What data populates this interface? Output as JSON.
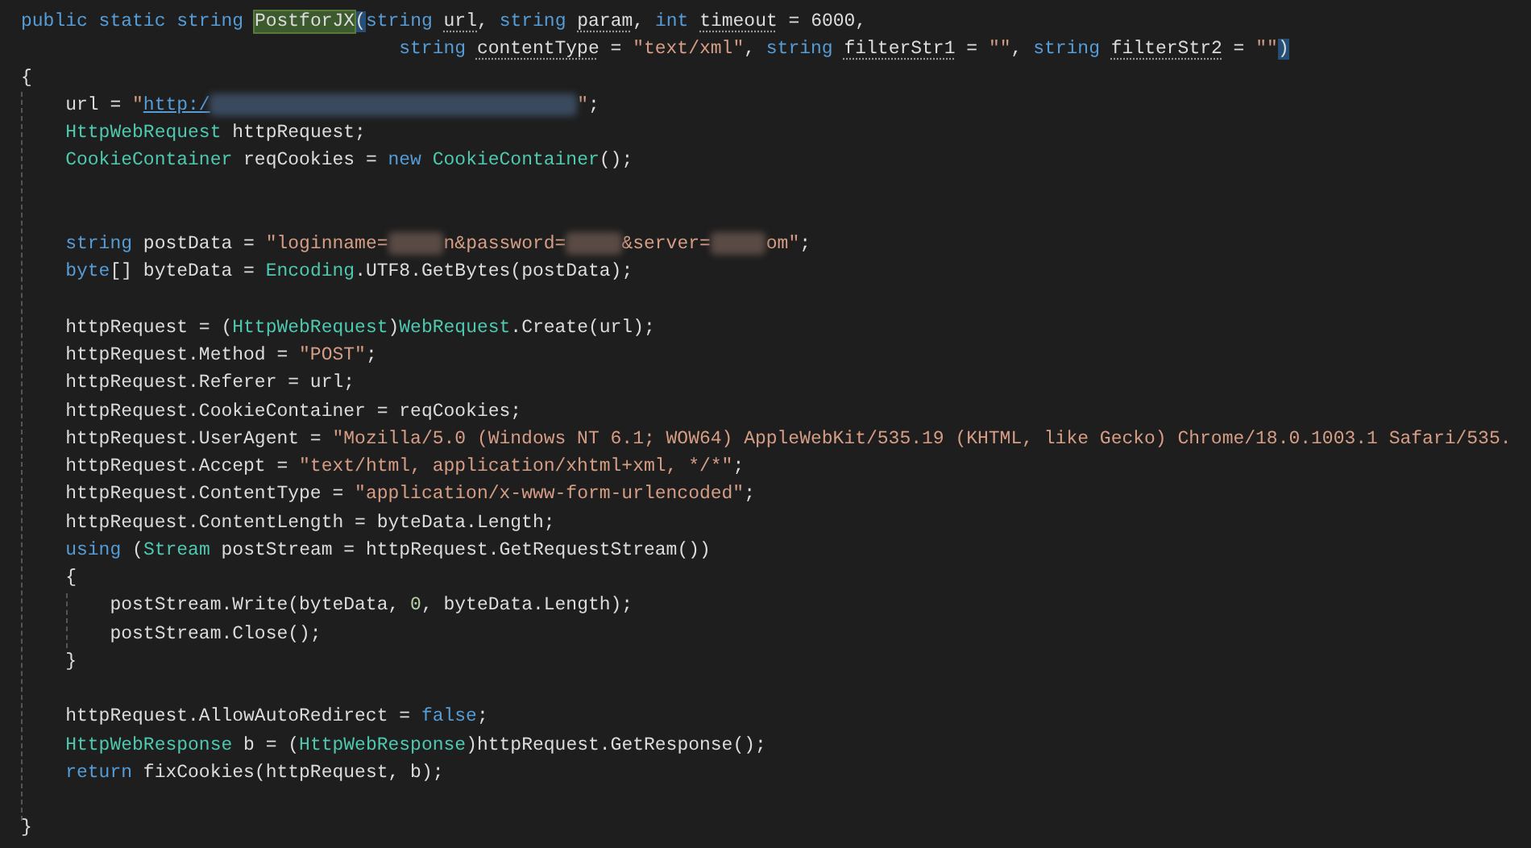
{
  "code_lines": [
    {
      "kind": "code",
      "tokens": [
        {
          "kind": "kw",
          "text": "public static string "
        },
        {
          "kind": "highlight",
          "text": "PostforJX"
        },
        {
          "kind": "match",
          "text": "("
        },
        {
          "kind": "kw",
          "text": "string "
        },
        {
          "kind": "hint",
          "text": "url"
        },
        {
          "kind": "plain",
          "text": ", "
        },
        {
          "kind": "kw",
          "text": "string "
        },
        {
          "kind": "hint",
          "text": "param"
        },
        {
          "kind": "plain",
          "text": ", "
        },
        {
          "kind": "kw",
          "text": "int "
        },
        {
          "kind": "hint",
          "text": "timeout"
        },
        {
          "kind": "plain",
          "text": " = 6000,"
        }
      ]
    },
    {
      "kind": "continuation",
      "tokens": [
        {
          "kind": "kw",
          "text": "string "
        },
        {
          "kind": "hint",
          "text": "contentType"
        },
        {
          "kind": "plain",
          "text": " = "
        },
        {
          "kind": "str",
          "text": "\"text/xml\""
        },
        {
          "kind": "plain",
          "text": ", "
        },
        {
          "kind": "kw",
          "text": "string "
        },
        {
          "kind": "hint",
          "text": "filterStr1"
        },
        {
          "kind": "plain",
          "text": " = "
        },
        {
          "kind": "str",
          "text": "\"\""
        },
        {
          "kind": "plain",
          "text": ", "
        },
        {
          "kind": "kw",
          "text": "string "
        },
        {
          "kind": "hint",
          "text": "filterStr2"
        },
        {
          "kind": "plain",
          "text": " = "
        },
        {
          "kind": "str",
          "text": "\"\""
        },
        {
          "kind": "match",
          "text": ")"
        }
      ]
    },
    {
      "kind": "code",
      "tokens": [
        {
          "kind": "plain",
          "text": "{"
        }
      ]
    },
    {
      "kind": "code",
      "tokens": [
        {
          "kind": "plain",
          "text": "    url = "
        },
        {
          "kind": "str",
          "text": "\""
        },
        {
          "kind": "link",
          "text": "http:/"
        },
        {
          "kind": "redacted_long"
        },
        {
          "kind": "str",
          "text": "\""
        },
        {
          "kind": "plain",
          "text": ";"
        }
      ]
    },
    {
      "kind": "code",
      "tokens": [
        {
          "kind": "type",
          "text": "    HttpWebRequest"
        },
        {
          "kind": "plain",
          "text": " httpRequest;"
        }
      ]
    },
    {
      "kind": "code",
      "tokens": [
        {
          "kind": "type",
          "text": "    CookieContainer"
        },
        {
          "kind": "plain",
          "text": " reqCookies = "
        },
        {
          "kind": "kw",
          "text": "new "
        },
        {
          "kind": "type",
          "text": "CookieContainer"
        },
        {
          "kind": "plain",
          "text": "();"
        }
      ]
    },
    {
      "kind": "blank"
    },
    {
      "kind": "blank"
    },
    {
      "kind": "code",
      "tokens": [
        {
          "kind": "kw",
          "text": "    string"
        },
        {
          "kind": "plain",
          "text": " postData = "
        },
        {
          "kind": "str",
          "text": "\"loginname="
        },
        {
          "kind": "redacted"
        },
        {
          "kind": "str",
          "text": "n&password="
        },
        {
          "kind": "redacted"
        },
        {
          "kind": "str",
          "text": "&server="
        },
        {
          "kind": "redacted"
        },
        {
          "kind": "str",
          "text": "om\""
        },
        {
          "kind": "plain",
          "text": ";"
        }
      ]
    },
    {
      "kind": "code",
      "tokens": [
        {
          "kind": "kw",
          "text": "    byte"
        },
        {
          "kind": "plain",
          "text": "[] byteData = "
        },
        {
          "kind": "type",
          "text": "Encoding"
        },
        {
          "kind": "plain",
          "text": ".UTF8.GetBytes(postData);"
        }
      ]
    },
    {
      "kind": "blank"
    },
    {
      "kind": "code",
      "tokens": [
        {
          "kind": "plain",
          "text": "    httpRequest = ("
        },
        {
          "kind": "type",
          "text": "HttpWebRequest"
        },
        {
          "kind": "plain",
          "text": ")"
        },
        {
          "kind": "type",
          "text": "WebRequest"
        },
        {
          "kind": "plain",
          "text": ".Create(url);"
        }
      ]
    },
    {
      "kind": "code",
      "tokens": [
        {
          "kind": "plain",
          "text": "    httpRequest.Method = "
        },
        {
          "kind": "str",
          "text": "\"POST\""
        },
        {
          "kind": "plain",
          "text": ";"
        }
      ]
    },
    {
      "kind": "code",
      "tokens": [
        {
          "kind": "plain",
          "text": "    httpRequest.Referer = url;"
        }
      ]
    },
    {
      "kind": "code",
      "tokens": [
        {
          "kind": "plain",
          "text": "    httpRequest.CookieContainer = reqCookies;"
        }
      ]
    },
    {
      "kind": "code",
      "tokens": [
        {
          "kind": "plain",
          "text": "    httpRequest.UserAgent = "
        },
        {
          "kind": "str",
          "text": "\"Mozilla/5.0 (Windows NT 6.1; WOW64) AppleWebKit/535.19 (KHTML, like Gecko) Chrome/18.0.1003.1 Safari/535."
        }
      ]
    },
    {
      "kind": "code",
      "tokens": [
        {
          "kind": "plain",
          "text": "    httpRequest.Accept = "
        },
        {
          "kind": "str",
          "text": "\"text/html, application/xhtml+xml, */*\""
        },
        {
          "kind": "plain",
          "text": ";"
        }
      ]
    },
    {
      "kind": "code",
      "tokens": [
        {
          "kind": "plain",
          "text": "    httpRequest.ContentType = "
        },
        {
          "kind": "str",
          "text": "\"application/x-www-form-urlencoded\""
        },
        {
          "kind": "plain",
          "text": ";"
        }
      ]
    },
    {
      "kind": "code",
      "tokens": [
        {
          "kind": "plain",
          "text": "    httpRequest.ContentLength = byteData.Length;"
        }
      ]
    },
    {
      "kind": "code",
      "tokens": [
        {
          "kind": "kw",
          "text": "    using"
        },
        {
          "kind": "plain",
          "text": " ("
        },
        {
          "kind": "type",
          "text": "Stream"
        },
        {
          "kind": "plain",
          "text": " postStream = httpRequest.GetRequestStream())"
        }
      ]
    },
    {
      "kind": "code",
      "tokens": [
        {
          "kind": "plain",
          "text": "    {"
        }
      ]
    },
    {
      "kind": "code",
      "tokens": [
        {
          "kind": "plain",
          "text": "        postStream.Write(byteData, "
        },
        {
          "kind": "num",
          "text": "0"
        },
        {
          "kind": "plain",
          "text": ", byteData.Length);"
        }
      ]
    },
    {
      "kind": "code",
      "tokens": [
        {
          "kind": "plain",
          "text": "        postStream.Close();"
        }
      ]
    },
    {
      "kind": "code",
      "tokens": [
        {
          "kind": "plain",
          "text": "    }"
        }
      ]
    },
    {
      "kind": "blank"
    },
    {
      "kind": "code",
      "tokens": [
        {
          "kind": "plain",
          "text": "    httpRequest.AllowAutoRedirect = "
        },
        {
          "kind": "kw",
          "text": "false"
        },
        {
          "kind": "plain",
          "text": ";"
        }
      ]
    },
    {
      "kind": "code",
      "tokens": [
        {
          "kind": "type",
          "text": "    HttpWebResponse"
        },
        {
          "kind": "plain",
          "text": " b = ("
        },
        {
          "kind": "type",
          "text": "HttpWebResponse"
        },
        {
          "kind": "plain",
          "text": ")httpRequest.GetResponse();"
        }
      ]
    },
    {
      "kind": "code",
      "tokens": [
        {
          "kind": "kw",
          "text": "    return"
        },
        {
          "kind": "plain",
          "text": " fixCookies(httpRequest, b);"
        }
      ]
    },
    {
      "kind": "blank"
    },
    {
      "kind": "code",
      "tokens": [
        {
          "kind": "plain",
          "text": "}"
        }
      ]
    }
  ]
}
